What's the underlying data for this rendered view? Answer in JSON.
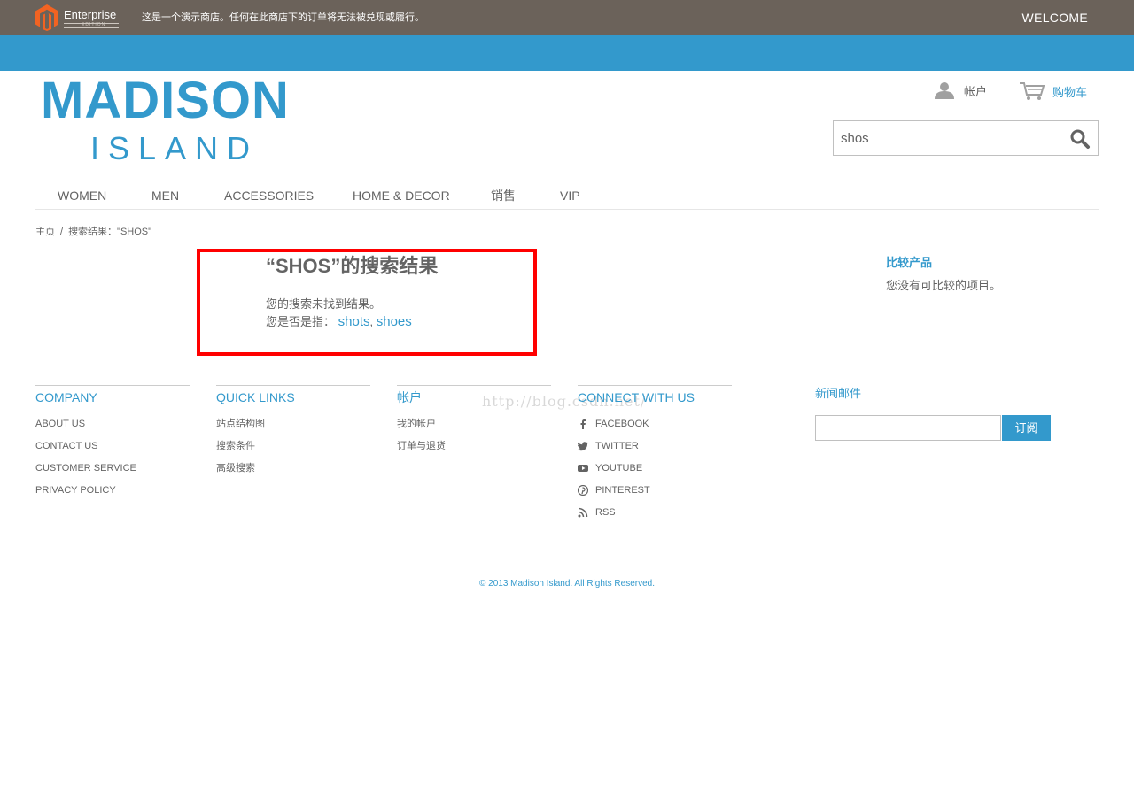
{
  "topbar": {
    "brand": "Enterprise",
    "brand_sub": "EDITION",
    "notice": "这是一个演示商店。任何在此商店下的订单将无法被兑现或履行。"
  },
  "welcome": "WELCOME",
  "logo": {
    "line1": "MADISON",
    "line2": "ISLAND"
  },
  "header": {
    "account_label": "帐户",
    "cart_label": "购物车",
    "search_value": "shos"
  },
  "nav": [
    "WOMEN",
    "MEN",
    "ACCESSORIES",
    "HOME & DECOR",
    "销售",
    "VIP"
  ],
  "breadcrumb": {
    "home": "主页",
    "separator": "/",
    "current": "搜索结果：\"SHOS\""
  },
  "results": {
    "title": "“SHOS”的搜索结果",
    "no_result": "您的搜索未找到结果。",
    "suggest_label": "您是否是指：",
    "suggestions": [
      "shots",
      "shoes"
    ],
    "suggest_sep": ","
  },
  "compare": {
    "title": "比较产品",
    "empty": "您没有可比较的项目。"
  },
  "footer": {
    "company": {
      "title": "COMPANY",
      "items": [
        "ABOUT US",
        "CONTACT US",
        "CUSTOMER SERVICE",
        "PRIVACY POLICY"
      ]
    },
    "quick_links": {
      "title": "QUICK LINKS",
      "items": [
        "站点结构图",
        "搜索条件",
        "高级搜索"
      ]
    },
    "account": {
      "title": "帐户",
      "items": [
        "我的帐户",
        "订单与退货"
      ]
    },
    "connect": {
      "title": "CONNECT WITH US",
      "items": [
        {
          "label": "FACEBOOK",
          "icon": "facebook-icon"
        },
        {
          "label": "TWITTER",
          "icon": "twitter-icon"
        },
        {
          "label": "YOUTUBE",
          "icon": "youtube-icon"
        },
        {
          "label": "PINTEREST",
          "icon": "pinterest-icon"
        },
        {
          "label": "RSS",
          "icon": "rss-icon"
        }
      ]
    },
    "newsletter": {
      "title": "新闻邮件",
      "button": "订阅"
    },
    "watermark": "http://blog.csdn.net/",
    "copyright": "© 2013 Madison Island. All Rights Reserved."
  },
  "colors": {
    "brand_blue": "#3399cc",
    "topbar": "#6b625a",
    "highlight_border": "#ff0000",
    "text": "#636363"
  }
}
